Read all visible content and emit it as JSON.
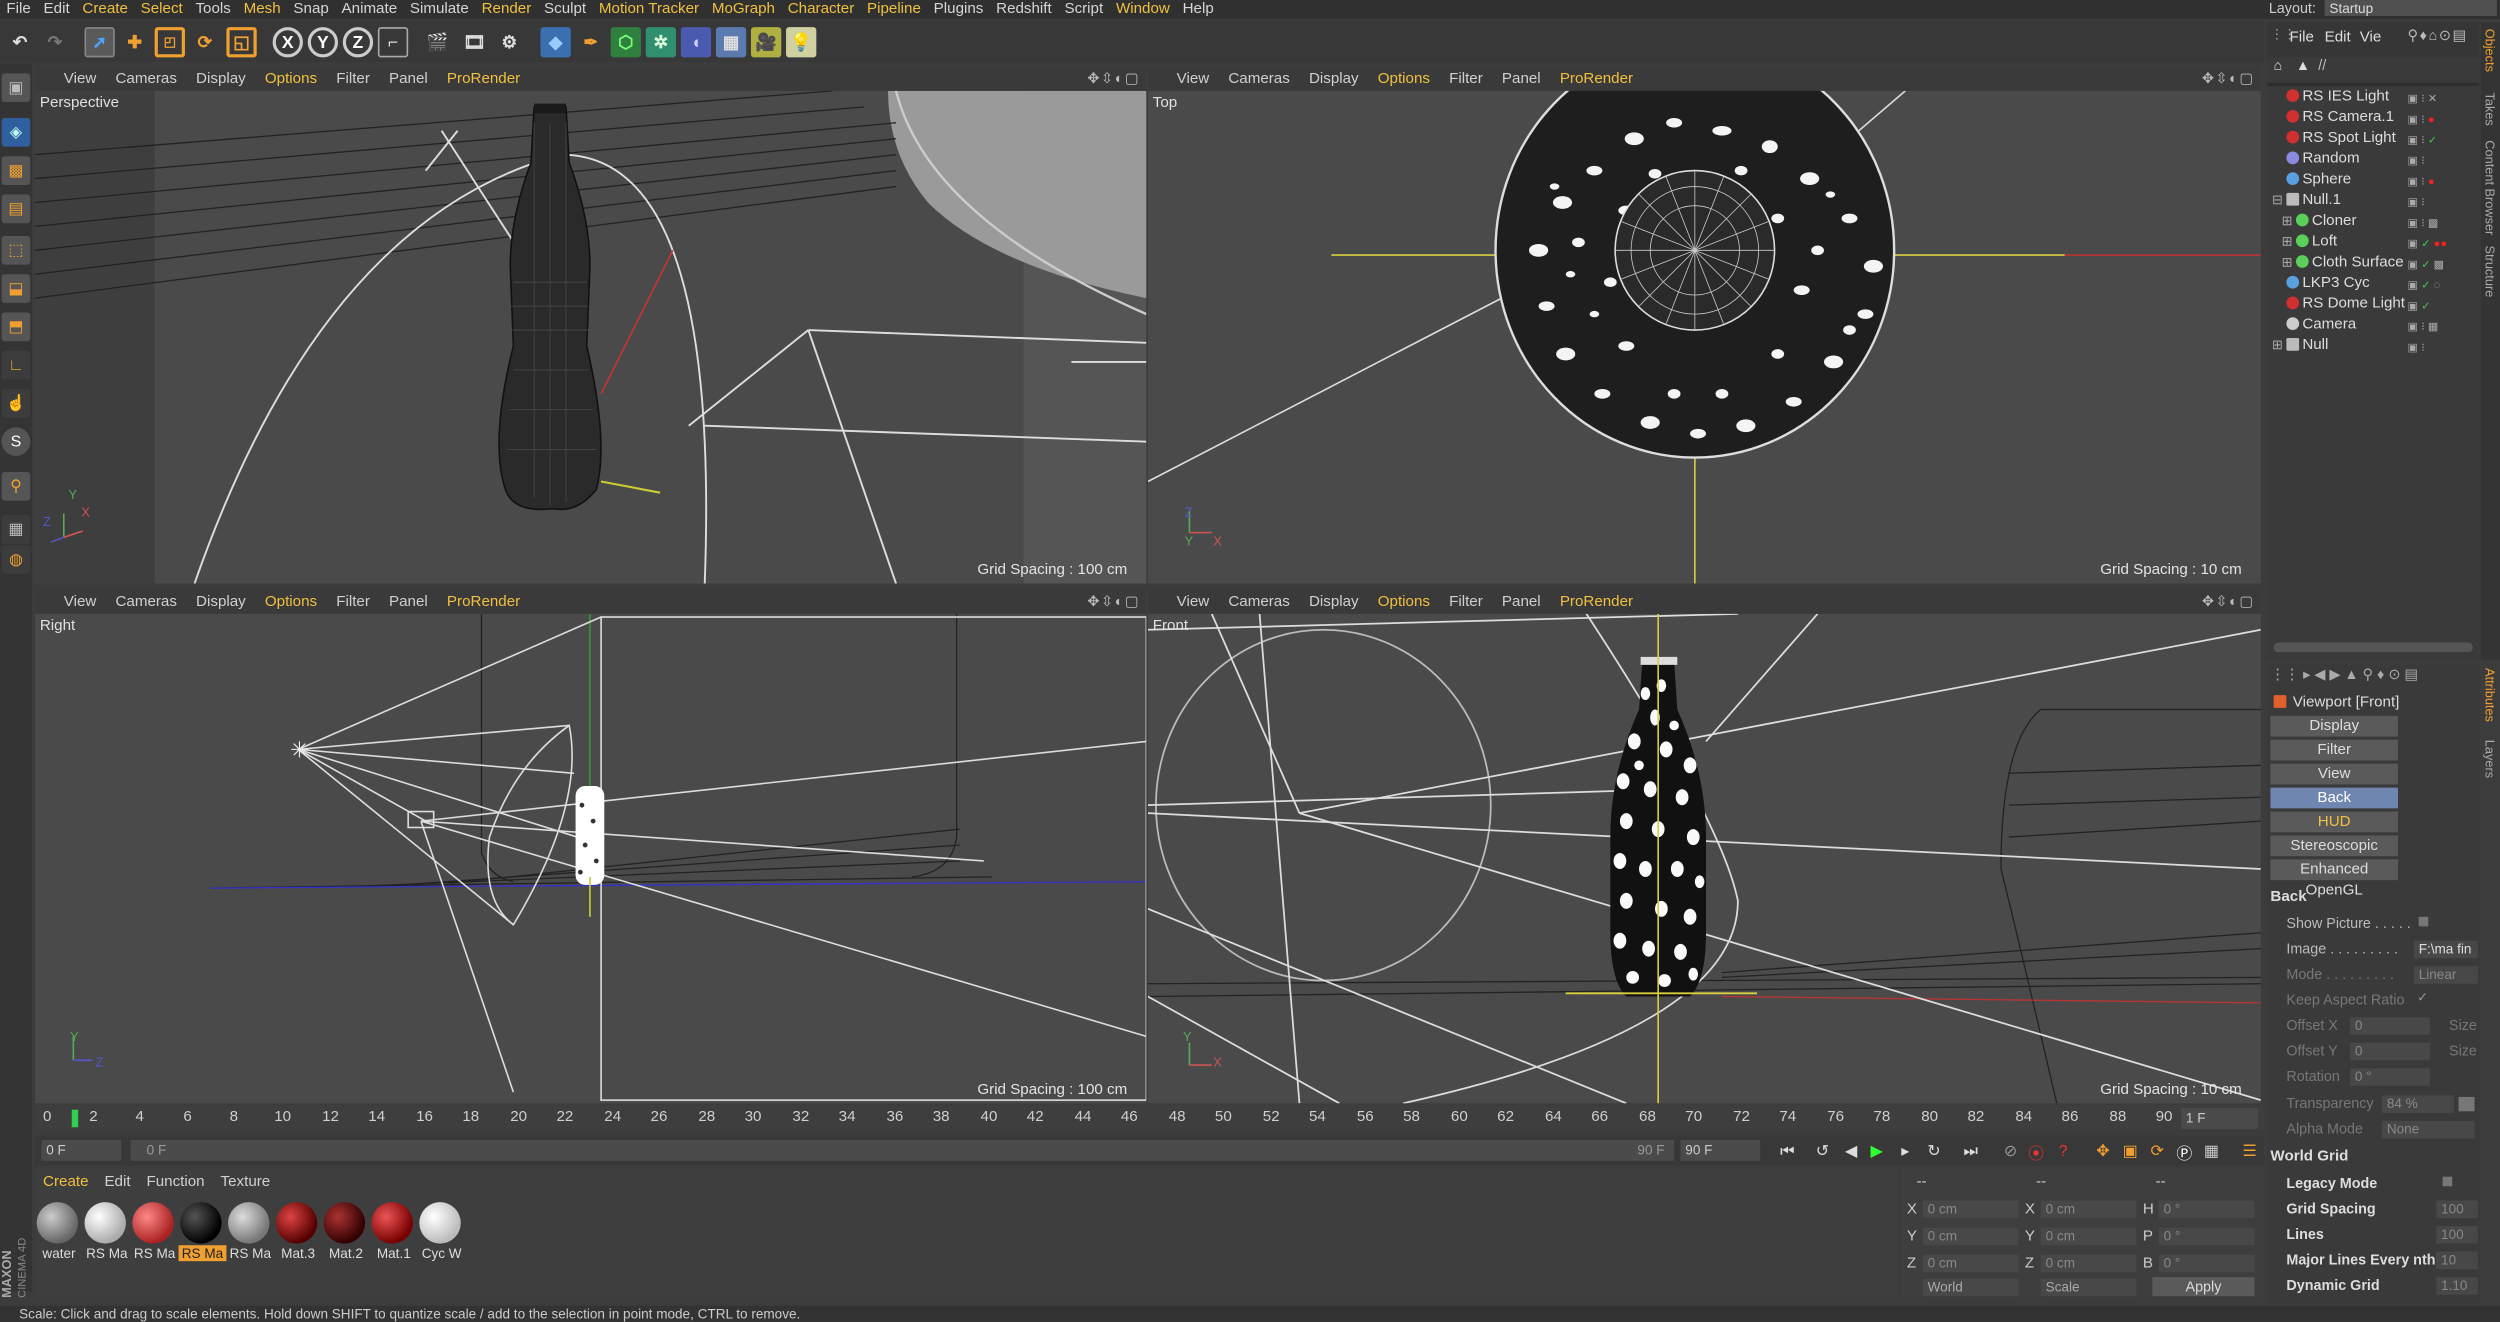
{
  "menubar": {
    "items": [
      {
        "label": "File"
      },
      {
        "label": "Edit"
      },
      {
        "label": "Create"
      },
      {
        "label": "Select"
      },
      {
        "label": "Tools"
      },
      {
        "label": "Mesh"
      },
      {
        "label": "Snap"
      },
      {
        "label": "Animate"
      },
      {
        "label": "Simulate"
      },
      {
        "label": "Render"
      },
      {
        "label": "Sculpt"
      },
      {
        "label": "Motion Tracker"
      },
      {
        "label": "MoGraph"
      },
      {
        "label": "Character"
      },
      {
        "label": "Pipeline"
      },
      {
        "label": "Plugins"
      },
      {
        "label": "Redshift"
      },
      {
        "label": "Script"
      },
      {
        "label": "Window"
      },
      {
        "label": "Help"
      }
    ],
    "layout_label": "Layout:",
    "layout_value": "Startup"
  },
  "toolbar": {
    "icons": [
      "undo-icon",
      "redo-icon",
      "live-selection-icon",
      "move-icon",
      "scale-icon",
      "rotate-icon",
      "recent-tool-icon",
      "x-axis-lock-icon",
      "y-axis-lock-icon",
      "z-axis-lock-icon",
      "coordinate-system-icon",
      "render-view-icon",
      "render-picture-viewer-icon",
      "render-settings-icon",
      "cube-icon",
      "pen-icon",
      "subdivision-icon",
      "array-icon",
      "deformer-icon",
      "floor-icon",
      "camera-icon",
      "light-icon"
    ],
    "axis_x": "X",
    "axis_y": "Y",
    "axis_z": "Z"
  },
  "viewport_menu": {
    "view": "View",
    "cameras": "Cameras",
    "display": "Display",
    "options": "Options",
    "filter": "Filter",
    "panel": "Panel",
    "prorender": "ProRender"
  },
  "viewports": {
    "perspective": {
      "name": "Perspective",
      "grid": "Grid Spacing : 100 cm"
    },
    "top": {
      "name": "Top",
      "grid": "Grid Spacing : 10 cm"
    },
    "right": {
      "name": "Right",
      "grid": "Grid Spacing : 100 cm"
    },
    "front": {
      "name": "Front",
      "grid": "Grid Spacing : 10 cm"
    }
  },
  "axes": {
    "x": "X",
    "y": "Y",
    "z": "Z"
  },
  "timeline": {
    "ticks": [
      "0",
      "2",
      "4",
      "6",
      "8",
      "10",
      "12",
      "14",
      "16",
      "18",
      "20",
      "22",
      "24",
      "26",
      "28",
      "30",
      "32",
      "34",
      "36",
      "38",
      "40",
      "42",
      "44",
      "46",
      "48",
      "50",
      "52",
      "54",
      "56",
      "58",
      "60",
      "62",
      "64",
      "66",
      "68",
      "70",
      "72",
      "74",
      "76",
      "78",
      "80",
      "82",
      "84",
      "86",
      "88",
      "90"
    ],
    "current_frame": "1 F",
    "start_field": "0 F",
    "range_start": "0 F",
    "range_end": "90 F",
    "end_field": "90 F"
  },
  "materials": {
    "menu": {
      "create": "Create",
      "edit": "Edit",
      "function": "Function",
      "texture": "Texture"
    },
    "items": [
      {
        "label": "water",
        "color": "#8a8a8a"
      },
      {
        "label": "RS Ma",
        "color": "#e8e8e8"
      },
      {
        "label": "RS Ma",
        "color": "#c83a3a"
      },
      {
        "label": "RS Ma",
        "color": "#1a1a1a",
        "selected": true
      },
      {
        "label": "RS Ma",
        "color": "#9a9a9a"
      },
      {
        "label": "Mat.3",
        "color": "#8a1818"
      },
      {
        "label": "Mat.2",
        "color": "#5a1010"
      },
      {
        "label": "Mat.1",
        "color": "#a01515"
      },
      {
        "label": "Cyc W",
        "color": "#f0f0f0"
      }
    ]
  },
  "coordinates": {
    "header_left": "--",
    "header_mid": "--",
    "header_right": "--",
    "pos_x": "0 cm",
    "pos_y": "0 cm",
    "pos_z": "0 cm",
    "size_x": "0 cm",
    "size_y": "0 cm",
    "size_z": "0 cm",
    "rot_h": "0 °",
    "rot_p": "0 °",
    "rot_b": "0 °",
    "labels": {
      "x": "X",
      "y": "Y",
      "z": "Z",
      "h": "H",
      "p": "P",
      "b": "B"
    },
    "mode_world": "World",
    "mode_scale": "Scale",
    "apply": "Apply"
  },
  "objects": {
    "menu": {
      "file": "File",
      "edit": "Edit",
      "view": "Vie"
    },
    "path": "//",
    "items": [
      {
        "label": "RS IES Light",
        "icon": "light-icon",
        "color": "#d03030"
      },
      {
        "label": "RS Camera.1",
        "icon": "camera-icon",
        "color": "#d03030"
      },
      {
        "label": "RS Spot Light",
        "icon": "spotlight-icon",
        "color": "#d03030"
      },
      {
        "label": "Random",
        "icon": "random-effector-icon",
        "color": "#8a8ae0"
      },
      {
        "label": "Sphere",
        "icon": "sphere-icon",
        "color": "#5aa0e0"
      },
      {
        "label": "Null.1",
        "icon": "null-icon",
        "color": "#bbbbbb"
      },
      {
        "label": "Cloner",
        "icon": "cloner-icon",
        "color": "#5ad05a"
      },
      {
        "label": "Loft",
        "icon": "loft-icon",
        "color": "#5ad05a"
      },
      {
        "label": "Cloth Surface",
        "icon": "cloth-surface-icon",
        "color": "#5ad05a"
      },
      {
        "label": "LKP3 Cyc",
        "icon": "cyc-icon",
        "color": "#5aa0e0"
      },
      {
        "label": "RS Dome Light",
        "icon": "dome-light-icon",
        "color": "#d03030"
      },
      {
        "label": "Camera",
        "icon": "camera-icon",
        "color": "#cccccc"
      },
      {
        "label": "Null",
        "icon": "null-icon",
        "color": "#bbbbbb"
      }
    ]
  },
  "side_tabs": {
    "objects": "Objects",
    "takes": "Takes",
    "content_browser": "Content Browser",
    "structure": "Structure",
    "attributes": "Attributes",
    "layers": "Layers"
  },
  "attributes": {
    "title": "Viewport [Front]",
    "tabs": [
      {
        "label": "Display"
      },
      {
        "label": "Filter"
      },
      {
        "label": "View"
      },
      {
        "label": "Back",
        "active": true
      },
      {
        "label": "HUD"
      },
      {
        "label": "Stereoscopic"
      },
      {
        "label": "Enhanced OpenGL"
      }
    ],
    "back_header": "Back",
    "show_picture": "Show Picture . . . . .",
    "image": "Image . . . . . . . . .",
    "image_value": "F:\\ma fin",
    "mode": "Mode . . . . . . . . .",
    "mode_value": "Linear",
    "keep_aspect": "Keep Aspect Ratio",
    "keep_aspect_check": "✓",
    "offset_x": "Offset X",
    "offset_x_value": "0",
    "offset_y": "Offset Y",
    "offset_y_value": "0",
    "size_x": "Size",
    "size_y": "Size",
    "rotation": "Rotation",
    "rotation_value": "0 °",
    "transparency": "Transparency",
    "transparency_value": "84 %",
    "alpha_mode": "Alpha Mode",
    "alpha_mode_value": "None",
    "world_grid_header": "World Grid",
    "legacy_mode": "Legacy Mode",
    "grid_spacing": "Grid Spacing",
    "grid_spacing_value": "100",
    "lines": "Lines",
    "lines_value": "100",
    "major_lines": "Major Lines Every nth",
    "major_lines_value": "10",
    "dynamic_grid": "Dynamic Grid",
    "dynamic_grid_value": "1.10"
  },
  "status": "Scale: Click and drag to scale elements. Hold down SHIFT to quantize scale / add to the selection in point mode, CTRL to remove.",
  "logo": {
    "line1": "MAXON",
    "line2": "CINEMA 4D"
  }
}
